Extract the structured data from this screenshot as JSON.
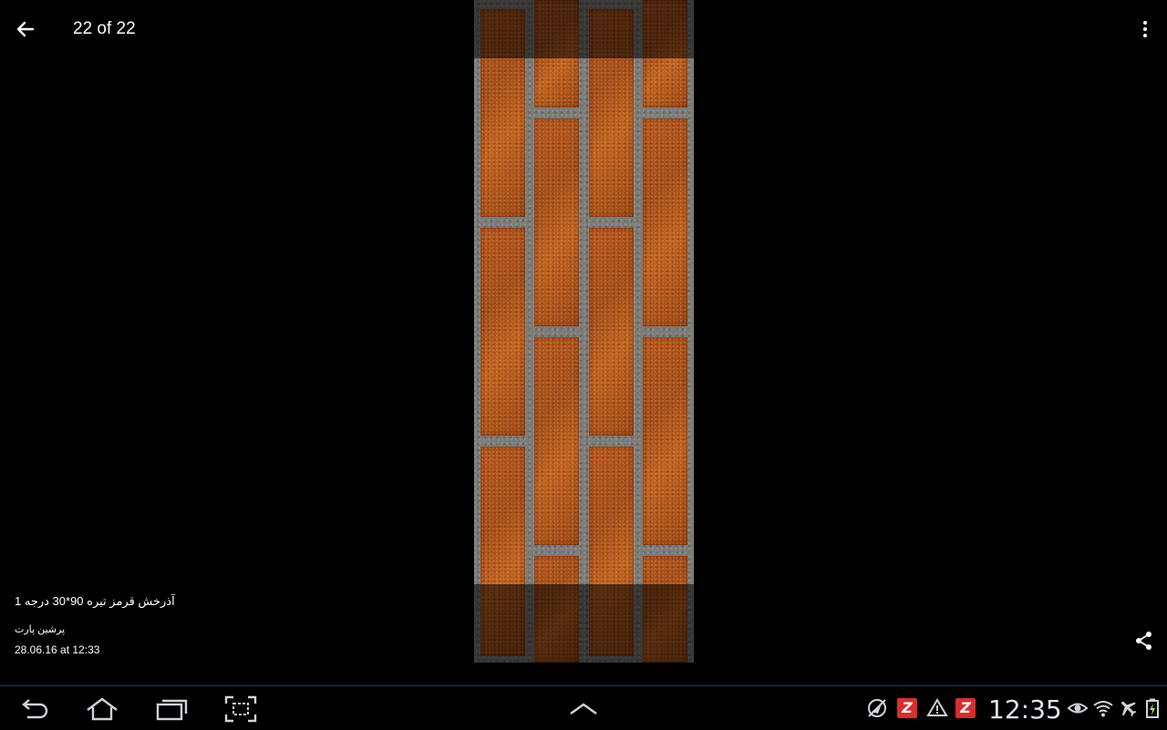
{
  "topbar": {
    "title": "22 of 22",
    "back_icon": "arrow-left-icon",
    "menu_icon": "more-vert-icon"
  },
  "photo": {
    "title": "آذرخش قرمز تیره 90*30 درجه 1",
    "source": "پرشین پارت",
    "date": "28.06.16 at 12:33"
  },
  "actions": {
    "share_icon": "share-icon"
  },
  "system_bar": {
    "time": "12:35",
    "nav_icons": [
      "back-nav-icon",
      "home-nav-icon",
      "recent-apps-icon",
      "screenshot-icon",
      "expand-up-icon"
    ],
    "status_icons": [
      "no-location-icon",
      "app-notification-icon",
      "warning-icon",
      "app-notification-icon",
      "eye-icon",
      "wifi-icon",
      "airplane-icon",
      "battery-charging-icon"
    ],
    "z_badge_label": "Z"
  },
  "colors": {
    "background": "#000000",
    "brick": "#a84f18",
    "grout": "#7d7b77",
    "status_text": "#dfe3e8",
    "badge_red": "#d92d2d"
  }
}
